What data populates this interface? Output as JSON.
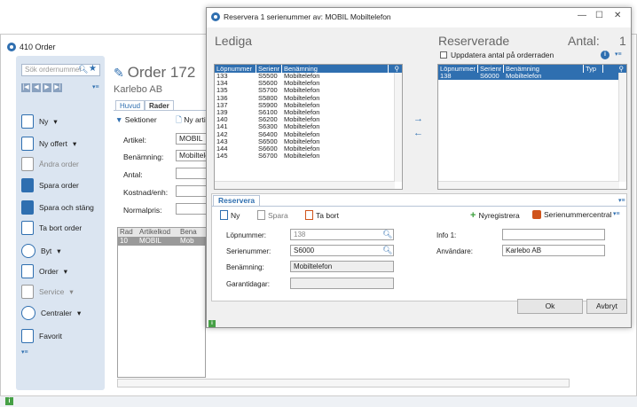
{
  "bg": {
    "title": "410 Order",
    "search_placeholder": "Sök ordernummer",
    "sidebar_items": [
      {
        "label": "Ny",
        "dropdown": true,
        "disabled": false
      },
      {
        "label": "Ny offert",
        "dropdown": true,
        "disabled": false
      },
      {
        "label": "Ändra order",
        "dropdown": false,
        "disabled": true
      },
      {
        "label": "Spara order",
        "dropdown": false,
        "disabled": false
      },
      {
        "label": "Spara och stäng",
        "dropdown": false,
        "disabled": false
      },
      {
        "label": "Ta bort order",
        "dropdown": false,
        "disabled": false
      },
      {
        "label": "Byt",
        "dropdown": true,
        "disabled": false
      },
      {
        "label": "Order",
        "dropdown": true,
        "disabled": false
      },
      {
        "label": "Service",
        "dropdown": true,
        "disabled": true
      },
      {
        "label": "Centraler",
        "dropdown": true,
        "disabled": false
      },
      {
        "label": "Favorit",
        "dropdown": false,
        "disabled": false
      }
    ],
    "order_title": "Order 172",
    "customer": "Karlebo AB",
    "tabs": [
      "Huvud",
      "Rader"
    ],
    "active_tab": "Rader",
    "sektioner": "Sektioner",
    "ny_artikel": "Ny arti",
    "form": [
      {
        "label": "Artikel:",
        "value": "MOBIL"
      },
      {
        "label": "Benämning:",
        "value": "Mobiltele"
      },
      {
        "label": "Antal:",
        "value": ""
      },
      {
        "label": "Kostnad/enh:",
        "value": ""
      },
      {
        "label": "Normalpris:",
        "value": ""
      }
    ],
    "table_headers": [
      "Rad",
      "Artikelkod",
      "Bena"
    ],
    "table_row": [
      "10",
      "MOBIL",
      "Mob"
    ]
  },
  "dialog": {
    "title": "Reservera 1 serienummer av: MOBIL Mobiltelefon",
    "lediga": "Lediga",
    "reserverade": "Reserverade",
    "antal_label": "Antal:",
    "antal_value": "1",
    "update_checkbox": "Uppdatera antal på orderraden",
    "left_headers": [
      "Löpnummer",
      "Serienr",
      "Benämning"
    ],
    "left_rows": [
      [
        "133",
        "S5500",
        "Mobiltelefon"
      ],
      [
        "134",
        "S5600",
        "Mobiltelefon"
      ],
      [
        "135",
        "S5700",
        "Mobiltelefon"
      ],
      [
        "136",
        "S5800",
        "Mobiltelefon"
      ],
      [
        "137",
        "S5900",
        "Mobiltelefon"
      ],
      [
        "139",
        "S6100",
        "Mobiltelefon"
      ],
      [
        "140",
        "S6200",
        "Mobiltelefon"
      ],
      [
        "141",
        "S6300",
        "Mobiltelefon"
      ],
      [
        "142",
        "S6400",
        "Mobiltelefon"
      ],
      [
        "143",
        "S6500",
        "Mobiltelefon"
      ],
      [
        "144",
        "S6600",
        "Mobiltelefon"
      ],
      [
        "145",
        "S6700",
        "Mobiltelefon"
      ]
    ],
    "right_headers": [
      "Löpnummer",
      "Serienr",
      "Benämning",
      "Typ"
    ],
    "right_rows": [
      [
        "138",
        "S6000",
        "Mobiltelefon",
        ""
      ]
    ],
    "reservera_tab": "Reservera",
    "toolbar": {
      "ny": "Ny",
      "spara": "Spara",
      "ta_bort": "Ta bort",
      "nyregistrera": "Nyregistrera",
      "serienummercentral": "Serienummercentral"
    },
    "fields": {
      "lopnummer_label": "Löpnummer:",
      "lopnummer_value": "138",
      "serienummer_label": "Serienummer:",
      "serienummer_value": "S6000",
      "benamning_label": "Benämning:",
      "benamning_value": "Mobiltelefon",
      "garantidagar_label": "Garantidagar:",
      "garantidagar_value": "",
      "info1_label": "Info 1:",
      "info1_value": "",
      "anvandare_label": "Användare:",
      "anvandare_value": "Karlebo AB"
    },
    "ok": "Ok",
    "avbryt": "Avbryt"
  }
}
